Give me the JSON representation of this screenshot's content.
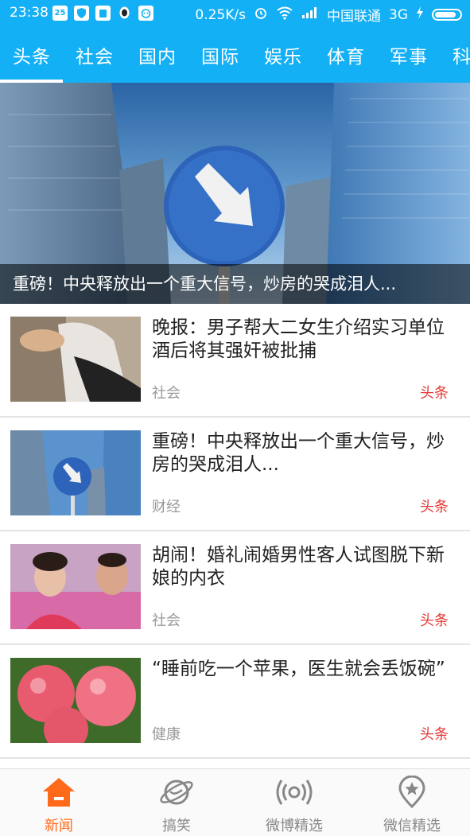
{
  "status": {
    "time": "23:38",
    "calendar_day": "25",
    "net_speed": "0.25K/s",
    "carrier": "中国联通",
    "network": "3G",
    "battery_level": 0.85,
    "icons": [
      "calendar-icon",
      "shield-icon",
      "android-icon",
      "qq-icon",
      "robot-icon",
      "alarm-icon",
      "wifi-icon",
      "signal-icon",
      "charging-icon",
      "battery-icon"
    ]
  },
  "tabs": [
    "头条",
    "社会",
    "国内",
    "国际",
    "娱乐",
    "体育",
    "军事",
    "科"
  ],
  "active_tab": "头条",
  "hero": {
    "caption": "重磅！中央释放出一个重大信号，炒房的哭成泪人..."
  },
  "news": [
    {
      "title": "晚报：男子帮大二女生介绍实习单位 酒后将其强奸被批捕",
      "category": "社会",
      "source": "头条"
    },
    {
      "title": "重磅！中央释放出一个重大信号，炒房的哭成泪人...",
      "category": "财经",
      "source": "头条"
    },
    {
      "title": "胡闹！婚礼闹婚男性客人试图脱下新娘的内衣",
      "category": "社会",
      "source": "头条"
    },
    {
      "title": "“睡前吃一个苹果，医生就会丢饭碗”",
      "category": "健康",
      "source": "头条"
    }
  ],
  "bottom_nav": [
    {
      "label": "新闻",
      "icon": "home-icon",
      "active": true
    },
    {
      "label": "搞笑",
      "icon": "planet-icon",
      "active": false
    },
    {
      "label": "微博精选",
      "icon": "broadcast-icon",
      "active": false
    },
    {
      "label": "微信精选",
      "icon": "location-star-icon",
      "active": false
    }
  ],
  "colors": {
    "primary": "#14b0f5",
    "active_nav": "#ff6a1a",
    "source_red": "#e53935"
  }
}
